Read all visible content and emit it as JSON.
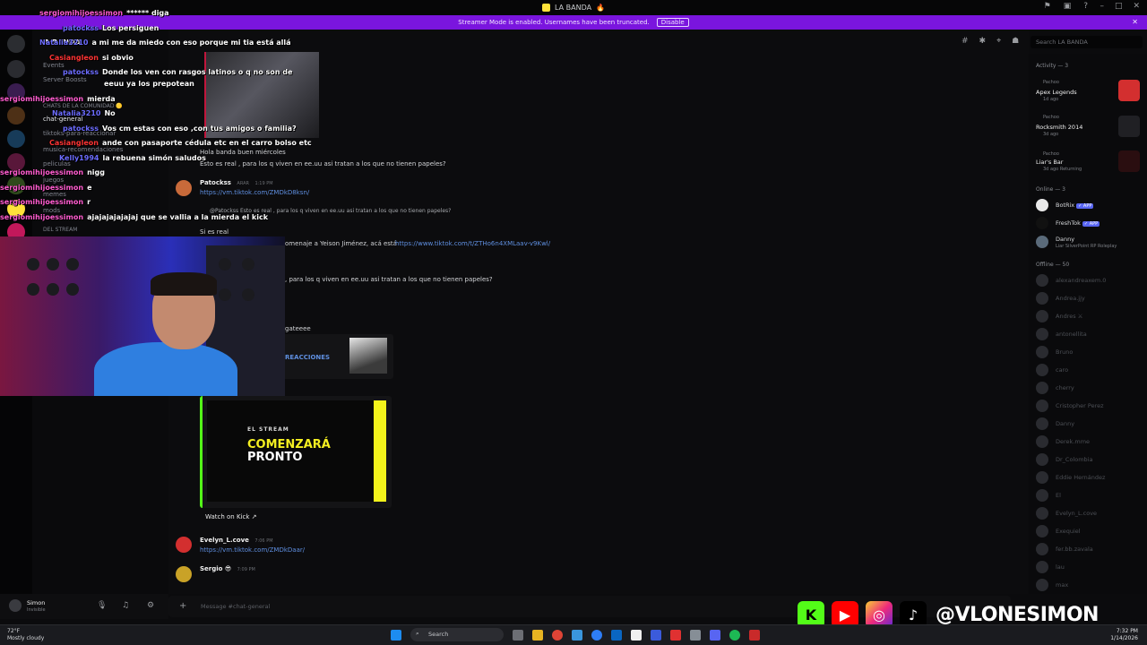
{
  "window": {
    "title": "LA BANDA",
    "title_emoji": "🔥"
  },
  "banner": {
    "text": "Streamer Mode is enabled. Usernames have been truncated.",
    "button": "Disable"
  },
  "server": {
    "name": "LA BANDA",
    "events": "Events",
    "boosts": "Server Boosts"
  },
  "channels": [
    {
      "label": "CHATS DE LA COMUNIDAD 🟡"
    },
    {
      "label": "chat-general"
    },
    {
      "label": "tiktoks-para-reaccionar"
    },
    {
      "label": "musica-recomendaciones"
    },
    {
      "label": "peliculas"
    },
    {
      "label": "juegos"
    },
    {
      "label": "memes"
    },
    {
      "label": "mods"
    },
    {
      "label": "DEL STREAM"
    }
  ],
  "search": {
    "placeholder": "Search LA BANDA"
  },
  "messages": {
    "m1_text": "Hola banda buen miércoles",
    "m2_text": "Esto es real , para los q viven en ee.uu asi tratan a los que no tienen papeles?",
    "m3_author": "Patockss",
    "m3_tag": "ARAR",
    "m3_time": "1:19 PM",
    "m3_link": "https://vm.tiktok.com/ZMDkD8ksn/",
    "m4_reply": "@Patockss Esto es real , para los q viven en ee.uu asi tratan a los que no tienen papeles?",
    "m4_text": "Si es real",
    "m5_text": "omenaje a Yeison Jiménez, acá está",
    "m5_link": "https://www.tiktok.com/t/ZTHo6n4XMLaav-v9Kwl/",
    "m6_text": ", para los q viven en ee.uu asi tratan a los que no tienen papeles?",
    "m7_text": "gateeee",
    "m8_text": "REACCIONES",
    "kick_small": "EL STREAM",
    "kick_big1": "COMENZARÁ",
    "kick_big2": "PRONTO",
    "watch_kick": "Watch on Kick",
    "evelyn_author": "Evelyn_L.cove",
    "evelyn_time": "7:06 PM",
    "evelyn_link": "https://vm.tiktok.com/ZMDkDaar/",
    "sergio_author": "Sergio 😎",
    "sergio_time": "7:09 PM"
  },
  "input": {
    "placeholder": "Message #chat-general"
  },
  "user": {
    "name": "Simon",
    "status": "Invisible"
  },
  "members": {
    "activity_title": "Activity — 3",
    "activities": [
      {
        "user": "Pachoo",
        "game": "Apex Legends",
        "time": "1d ago",
        "color": "#d32f2f"
      },
      {
        "user": "Pachoo",
        "game": "Rocksmith 2014",
        "time": "3d ago",
        "color": "#202024"
      },
      {
        "user": "Pachoo",
        "game": "Liar's Bar",
        "time": "3d ago",
        "extra": "Returning",
        "color": "#2a0e10"
      }
    ],
    "online_title": "Online — 3",
    "online": [
      {
        "name": "BotRix",
        "badge": "✓ APP"
      },
      {
        "name": "FreshTok",
        "badge": "✓ APP"
      },
      {
        "name": "Danny",
        "sub": "Liar SilverPoint RP Roleplay"
      }
    ],
    "offline_title": "Offline — 50",
    "offline": [
      "alexandreaxem.0",
      "Andrea.jjy",
      "Andres ⚔",
      "antonellita",
      "Bruno",
      "caro",
      "cherry",
      "Cristopher Perez",
      "Danny",
      "Derek.mme",
      "Dr_Colombia",
      "Eddie Hernández",
      "El",
      "Evelyn_L.cove",
      "Exequiel",
      "fer.bb.zavala",
      "lau",
      "max"
    ]
  },
  "overlay": [
    {
      "user": "sergiomihijoessimon",
      "msg": "****** diga",
      "color": "pink"
    },
    {
      "user": "patockss",
      "msg": "Los persiguen",
      "color": "blue"
    },
    {
      "user": "Natalia3210",
      "msg": "a mi me da miedo con eso porque mi tia está allá",
      "color": "blue"
    },
    {
      "user": "Casiangleon",
      "msg": "si obvio",
      "color": "red"
    },
    {
      "user": "patockss",
      "msg": "Donde los ven con rasgos latinos o q no son de",
      "color": "blue"
    },
    {
      "user": "",
      "msg": "eeuu ya los prepotean",
      "color": "blue"
    },
    {
      "user": "sergiomihijoessimon",
      "msg": "mierda",
      "color": "pink"
    },
    {
      "user": "Natalia3210",
      "msg": "No",
      "color": "blue"
    },
    {
      "user": "patockss",
      "msg": "Vos cm estas con eso ,con tus amigos o familia?",
      "color": "blue"
    },
    {
      "user": "Casiangleon",
      "msg": "ande con pasaporte cédula etc en el carro bolso etc",
      "color": "red"
    },
    {
      "user": "Kelly1994",
      "msg": "la rebuena simón saludos",
      "color": "blue"
    },
    {
      "user": "sergiomihijoessimon",
      "msg": "nigg",
      "color": "pink"
    },
    {
      "user": "sergiomihijoessimon",
      "msg": "e",
      "color": "pink"
    },
    {
      "user": "sergiomihijoessimon",
      "msg": "r",
      "color": "pink"
    },
    {
      "user": "sergiomihijoessimon",
      "msg": "ajajajajajajaj que se vallia a la mierda el kick",
      "color": "pink"
    }
  ],
  "social": {
    "handle": "@VLONESIMON",
    "kick": "K",
    "youtube": "▶",
    "instagram": "◎",
    "tiktok": "♪"
  },
  "taskbar": {
    "temp": "72°F",
    "weather": "Mostly cloudy",
    "search": "Search",
    "time": "7:32 PM",
    "date": "1/14/2026"
  }
}
